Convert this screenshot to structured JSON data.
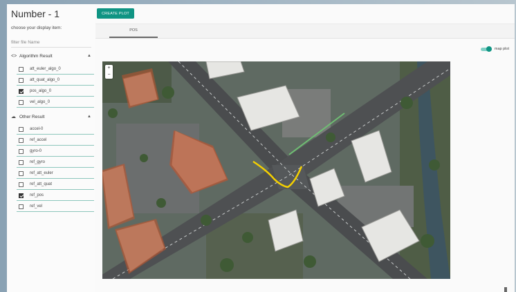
{
  "sidebar": {
    "title": "Number - 1",
    "subtitle": "choose your display item:",
    "filter_placeholder": "filter file Name",
    "groups": [
      {
        "label": "Algorithm Result",
        "icon": "code-icon",
        "items": [
          {
            "label": "att_euler_algo_0",
            "checked": false
          },
          {
            "label": "att_quat_algo_0",
            "checked": false
          },
          {
            "label": "pos_algo_0",
            "checked": true
          },
          {
            "label": "vel_algo_0",
            "checked": false
          }
        ]
      },
      {
        "label": "Other Result",
        "icon": "cloud-icon",
        "items": [
          {
            "label": "accel-0",
            "checked": false
          },
          {
            "label": "ref_accel",
            "checked": false
          },
          {
            "label": "gyro-0",
            "checked": false
          },
          {
            "label": "ref_gyro",
            "checked": false
          },
          {
            "label": "ref_att_euler",
            "checked": false
          },
          {
            "label": "ref_att_quat",
            "checked": false
          },
          {
            "label": "ref_pos",
            "checked": true
          },
          {
            "label": "ref_vel",
            "checked": false
          }
        ]
      }
    ]
  },
  "toolbar": {
    "create_label": "CREATE PLOT"
  },
  "tabs": [
    {
      "label": "POS",
      "active": true
    }
  ],
  "map_toggle": {
    "label": "map plot",
    "on": true
  },
  "map": {
    "zoom_in": "+",
    "zoom_out": "−"
  },
  "colors": {
    "accent": "#0f9483",
    "track": "#f5d000"
  }
}
